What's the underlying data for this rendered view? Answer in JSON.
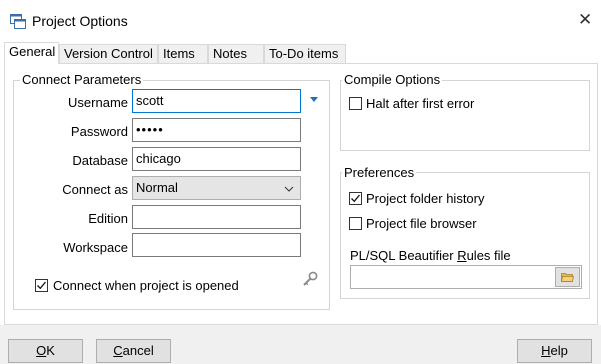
{
  "window": {
    "title": "Project Options",
    "close_glyph": "✕"
  },
  "tabs": [
    {
      "label": "General",
      "active": true
    },
    {
      "label": "Version Control",
      "active": false
    },
    {
      "label": "Items",
      "active": false
    },
    {
      "label": "Notes",
      "active": false
    },
    {
      "label": "To-Do items",
      "active": false
    }
  ],
  "connect": {
    "legend": "Connect Parameters",
    "username_label": "Username",
    "username_value": "scott",
    "password_label": "Password",
    "password_value": "•••••",
    "database_label": "Database",
    "database_value": "chicago",
    "connect_as_label": "Connect as",
    "connect_as_value": "Normal",
    "edition_label": "Edition",
    "edition_value": "",
    "workspace_label": "Workspace",
    "workspace_value": "",
    "connect_on_open_label": "Connect when project is opened",
    "connect_on_open_checked": true
  },
  "compile": {
    "legend": "Compile Options",
    "halt_label": "Halt after first error",
    "halt_checked": false
  },
  "preferences": {
    "legend": "Preferences",
    "folder_history_label": "Project folder history",
    "folder_history_checked": true,
    "file_browser_label": "Project file browser",
    "file_browser_checked": false,
    "beautifier_label_pre": "PL/SQL Beautifier ",
    "beautifier_label_accel": "R",
    "beautifier_label_post": "ules file",
    "beautifier_value": ""
  },
  "buttons": {
    "ok_accel": "O",
    "ok_rest": "K",
    "cancel_accel": "C",
    "cancel_rest": "ancel",
    "help_accel": "H",
    "help_rest": "elp"
  },
  "colors": {
    "focus_border": "#0078d7",
    "dropdown_arrow": "#1f6fbf",
    "folder_icon": "#e8b84a"
  }
}
